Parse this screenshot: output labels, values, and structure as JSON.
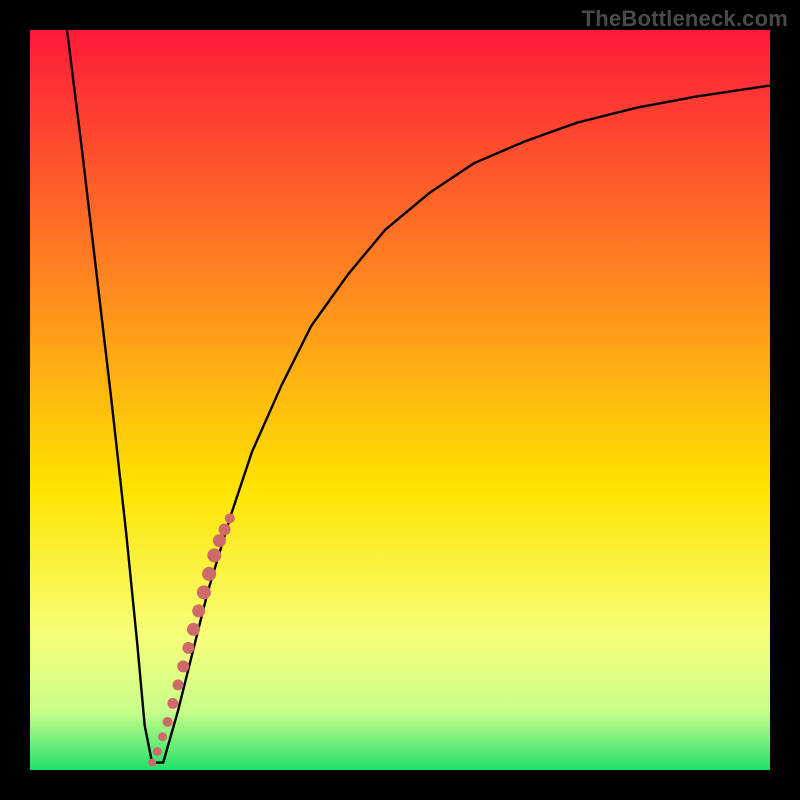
{
  "watermark": "TheBottleneck.com",
  "colors": {
    "frame": "#000000",
    "curve": "#000000",
    "dot": "#cf6a6a",
    "grad_top": "#ff1a3a",
    "grad_mid1": "#ff8a1f",
    "grad_mid2": "#ffe400",
    "grad_mid3": "#f6ff7a",
    "grad_mid4": "#c9ff8a",
    "grad_bot": "#22e06a"
  },
  "chart_data": {
    "type": "line",
    "title": "",
    "xlabel": "",
    "ylabel": "",
    "xlim": [
      0,
      100
    ],
    "ylim": [
      0,
      100
    ],
    "series": [
      {
        "name": "bottleneck-curve",
        "x": [
          5,
          7,
          9,
          11,
          13,
          14.5,
          15.5,
          16.5,
          18,
          20,
          22,
          24,
          27,
          30,
          34,
          38,
          43,
          48,
          54,
          60,
          67,
          74,
          82,
          90,
          100
        ],
        "y": [
          100,
          84,
          67,
          50,
          32,
          17,
          6,
          1,
          1,
          8,
          16,
          24,
          34,
          43,
          52,
          60,
          67,
          73,
          78,
          82,
          85,
          87.5,
          89.5,
          91,
          92.5
        ]
      }
    ],
    "dots": {
      "name": "highlight-dots",
      "x": [
        16.5,
        17.2,
        17.9,
        18.6,
        19.3,
        20.0,
        20.7,
        21.4,
        22.1,
        22.8,
        23.5,
        24.2,
        24.9,
        25.6,
        26.3,
        27.0
      ],
      "y": [
        1.0,
        2.5,
        4.5,
        6.5,
        9.0,
        11.5,
        14.0,
        16.5,
        19.0,
        21.5,
        24.0,
        26.5,
        29.0,
        31.0,
        32.5,
        34.0
      ],
      "r": [
        4,
        4.5,
        4.5,
        5,
        5.5,
        5.5,
        6,
        6,
        6.5,
        6.5,
        7,
        7,
        7,
        6.5,
        6,
        5
      ]
    }
  }
}
